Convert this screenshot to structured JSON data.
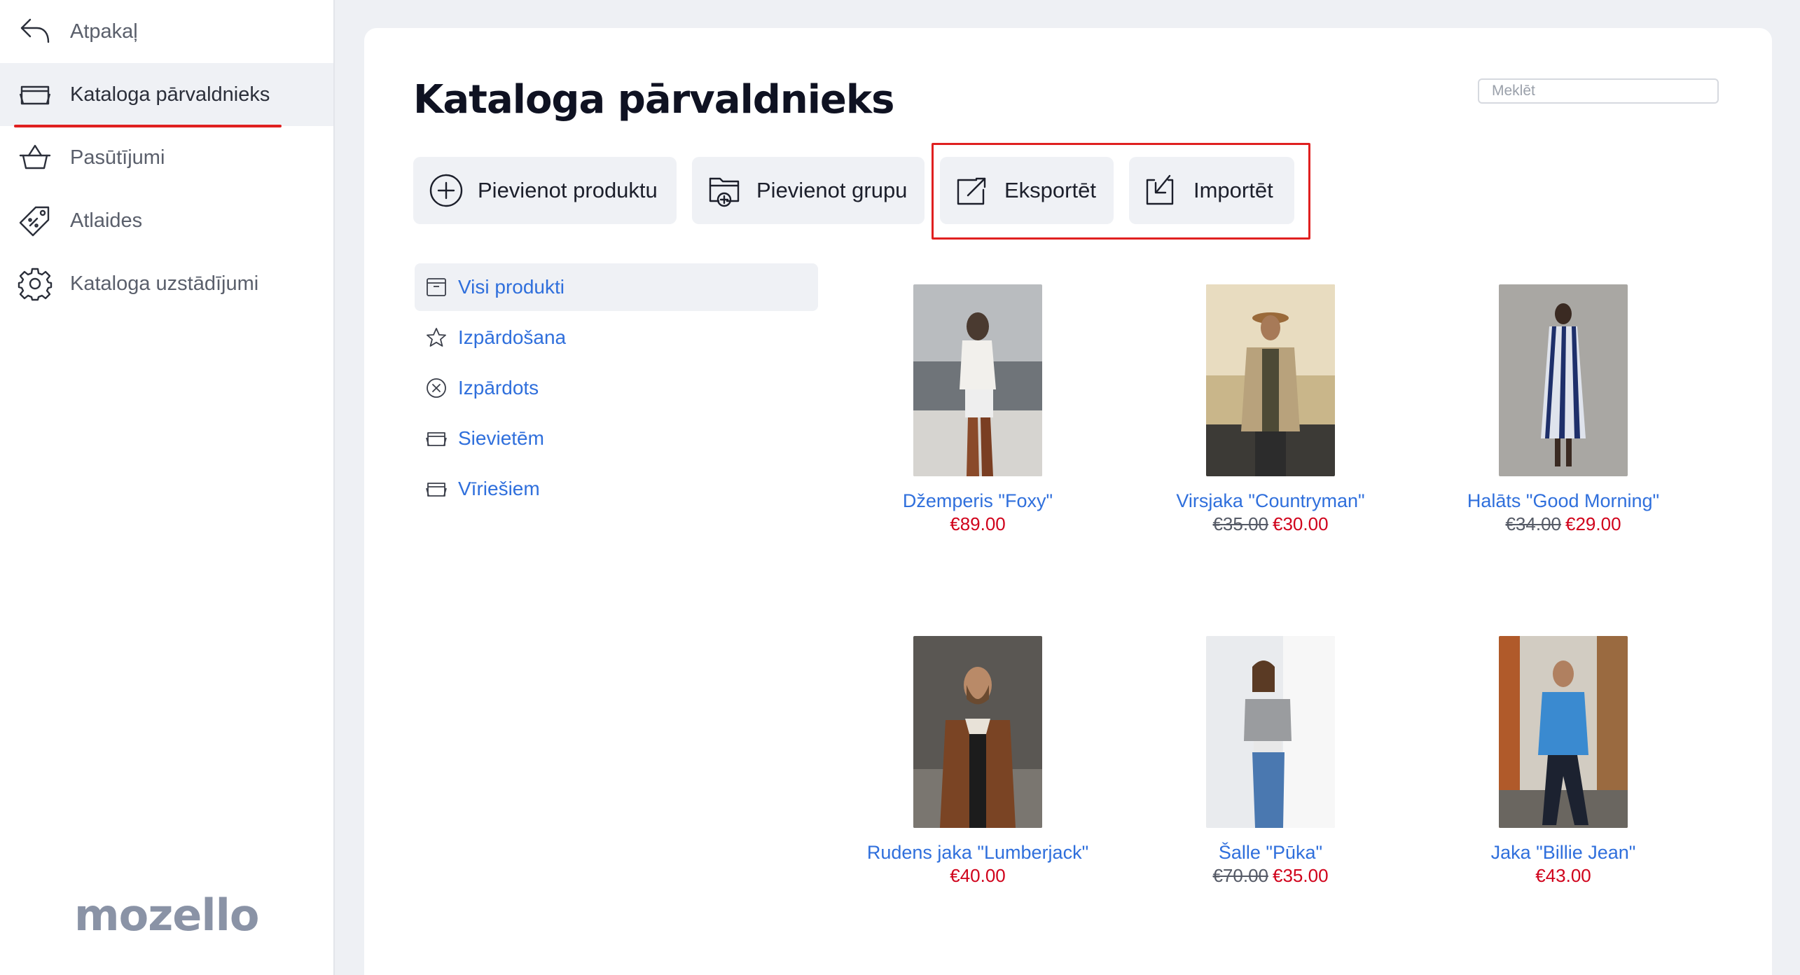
{
  "sidebar": {
    "items": [
      {
        "label": "Atpakaļ",
        "icon": "back-arrow-icon"
      },
      {
        "label": "Kataloga pārvaldnieks",
        "icon": "folder-icon"
      },
      {
        "label": "Pasūtījumi",
        "icon": "basket-icon"
      },
      {
        "label": "Atlaides",
        "icon": "discount-tag-icon"
      },
      {
        "label": "Kataloga uzstādījumi",
        "icon": "gear-icon"
      }
    ],
    "logo": "mozello"
  },
  "main": {
    "title": "Kataloga pārvaldnieks",
    "search_placeholder": "Meklēt",
    "toolbar": {
      "add_product": "Pievienot produktu",
      "add_group": "Pievienot grupu",
      "export": "Eksportēt",
      "import": "Importēt"
    },
    "categories": [
      {
        "label": "Visi produkti",
        "icon": "box-icon"
      },
      {
        "label": "Izpārdošana",
        "icon": "star-icon"
      },
      {
        "label": "Izpārdots",
        "icon": "circle-x-icon"
      },
      {
        "label": "Sievietēm",
        "icon": "folder-icon"
      },
      {
        "label": "Vīriešiem",
        "icon": "folder-icon"
      }
    ],
    "products": [
      {
        "name": "Džemperis \"Foxy\"",
        "old_price": "",
        "price": "€89.00"
      },
      {
        "name": "Virsjaka \"Countryman\"",
        "old_price": "€35.00",
        "price": "€30.00"
      },
      {
        "name": "Halāts \"Good Morning\"",
        "old_price": "€34.00",
        "price": "€29.00"
      },
      {
        "name": "Rudens jaka \"Lumberjack\"",
        "old_price": "",
        "price": "€40.00"
      },
      {
        "name": "Šalle \"Pūka\"",
        "old_price": "€70.00",
        "price": "€35.00"
      },
      {
        "name": "Jaka \"Billie Jean\"",
        "old_price": "",
        "price": "€43.00"
      }
    ]
  },
  "colors": {
    "accent": "#e02020",
    "link": "#2f6fdc",
    "sale_price": "#d0021b"
  }
}
